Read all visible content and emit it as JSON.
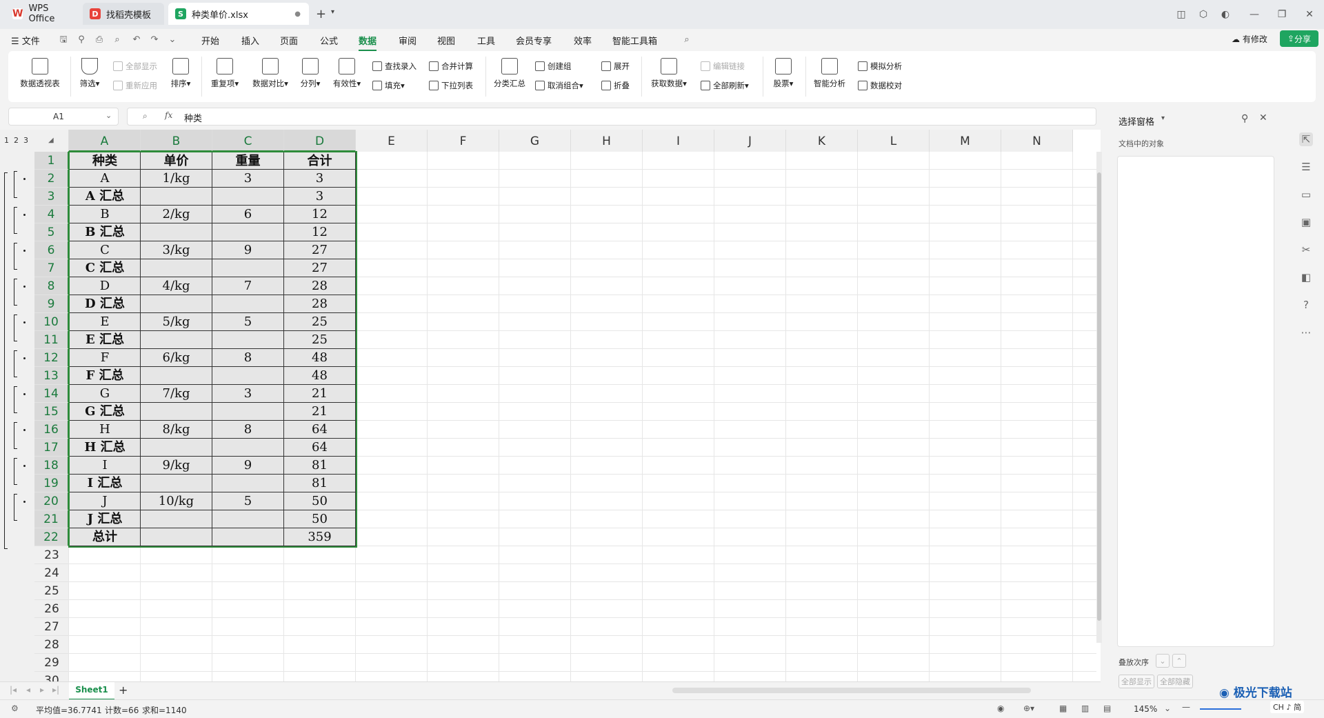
{
  "titlebar": {
    "tabs": [
      {
        "label": "WPS Office",
        "icon": "wps-logo-icon",
        "color": "#d93a2e"
      },
      {
        "label": "找稻壳模板",
        "icon": "docer-icon",
        "color": "#e8423a"
      },
      {
        "label": "种类单价.xlsx",
        "icon": "sheet-s-icon",
        "color": "#1fa560"
      }
    ],
    "new_tab": "+"
  },
  "menu": {
    "file": "文件",
    "items": [
      "开始",
      "插入",
      "页面",
      "公式",
      "数据",
      "审阅",
      "视图",
      "工具",
      "会员专享",
      "效率",
      "智能工具箱"
    ],
    "active": "数据",
    "modified": "有修改",
    "share": "分享"
  },
  "ribbon": {
    "pivot": "数据透视表",
    "filter": "筛选",
    "show_all": "全部显示",
    "reapply": "重新应用",
    "sort": "排序",
    "duplicates": "重复项",
    "compare": "数据对比",
    "split": "分列",
    "validity": "有效性",
    "lookup": "查找录入",
    "fill": "填充",
    "consolidate": "合并计算",
    "dropdown": "下拉列表",
    "subtotal": "分类汇总",
    "create_group": "创建组",
    "ungroup": "取消组合",
    "expand": "展开",
    "collapse": "折叠",
    "get_data": "获取数据",
    "edit_links": "编辑链接",
    "refresh_all": "全部刷新",
    "stocks": "股票",
    "smart_analysis": "智能分析",
    "simulation": "模拟分析",
    "proofread": "数据校对"
  },
  "formula_bar": {
    "cell_ref": "A1",
    "fx": "fx",
    "content": "种类"
  },
  "columns": [
    "A",
    "B",
    "C",
    "D",
    "E",
    "F",
    "G",
    "H",
    "I",
    "J",
    "K",
    "L",
    "M",
    "N"
  ],
  "outline_levels": [
    "1",
    "2",
    "3"
  ],
  "rows": [
    [
      "种类",
      "单价",
      "重量",
      "合计"
    ],
    [
      "A",
      "1/kg",
      "3",
      "3"
    ],
    [
      "A 汇总",
      "",
      "",
      "3"
    ],
    [
      "B",
      "2/kg",
      "6",
      "12"
    ],
    [
      "B 汇总",
      "",
      "",
      "12"
    ],
    [
      "C",
      "3/kg",
      "9",
      "27"
    ],
    [
      "C 汇总",
      "",
      "",
      "27"
    ],
    [
      "D",
      "4/kg",
      "7",
      "28"
    ],
    [
      "D 汇总",
      "",
      "",
      "28"
    ],
    [
      "E",
      "5/kg",
      "5",
      "25"
    ],
    [
      "E 汇总",
      "",
      "",
      "25"
    ],
    [
      "F",
      "6/kg",
      "8",
      "48"
    ],
    [
      "F 汇总",
      "",
      "",
      "48"
    ],
    [
      "G",
      "7/kg",
      "3",
      "21"
    ],
    [
      "G 汇总",
      "",
      "",
      "21"
    ],
    [
      "H",
      "8/kg",
      "8",
      "64"
    ],
    [
      "H 汇总",
      "",
      "",
      "64"
    ],
    [
      "I",
      "9/kg",
      "9",
      "81"
    ],
    [
      "I 汇总",
      "",
      "",
      "81"
    ],
    [
      "J",
      "10/kg",
      "5",
      "50"
    ],
    [
      "J 汇总",
      "",
      "",
      "50"
    ],
    [
      "总计",
      "",
      "",
      "359"
    ]
  ],
  "extra_rows": [
    "23",
    "24",
    "25",
    "26",
    "27",
    "28",
    "29",
    "30"
  ],
  "sheet_tabs": {
    "active": "Sheet1",
    "add": "+"
  },
  "status": {
    "average": "平均值=36.7741",
    "count": "计数=66",
    "sum": "求和=1140",
    "zoom": "145%"
  },
  "pane": {
    "title": "选择窗格",
    "subtitle": "文档中的对象",
    "order_label": "叠放次序",
    "show_all": "全部显示",
    "hide_all": "全部隐藏"
  },
  "watermark": {
    "text": "极光下载站",
    "ime": "CH ♪ 简"
  },
  "colors": {
    "accent": "#1fa560",
    "selection": "#2e8b3a",
    "cell_bg": "#e6e6e6"
  }
}
